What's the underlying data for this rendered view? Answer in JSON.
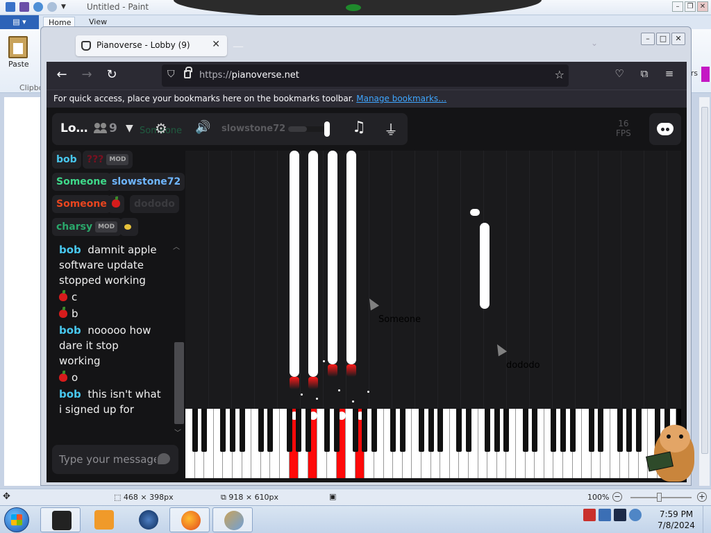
{
  "paint": {
    "title": "Untitled - Paint",
    "tabs": [
      "Home",
      "View"
    ],
    "paste_label": "Paste",
    "clipboard_label": "Clipbo",
    "right_edge_label": "it\nors",
    "status": {
      "selection_size": "468 × 398px",
      "canvas_size": "918 × 610px",
      "zoom": "100%"
    }
  },
  "firefox": {
    "tab_title": "Pianoverse - Lobby (9)",
    "url_proto": "https://",
    "url_host": "pianoverse.net",
    "bookmarks_text": "For quick access, place your bookmarks here on the bookmarks toolbar.",
    "bookmarks_link": "Manage bookmarks…"
  },
  "pianoverse": {
    "room_title": "Lo…",
    "user_count": "9",
    "toolbar_name": "slowstone72",
    "ghost_name": "Someone",
    "volume_level": 0.45,
    "fps_value": "16",
    "fps_label": "FPS",
    "users": [
      {
        "name": "bob",
        "color": "#48c7ee"
      },
      {
        "name": "???",
        "color": "#7a1020",
        "mod": "MOD"
      },
      {
        "name": "Someone",
        "color": "#3fd98a"
      },
      {
        "name": "slowstone72",
        "color": "#6fb6ff"
      },
      {
        "name": "Someone",
        "color": "#e8451f"
      },
      {
        "name": "dododo",
        "color": "#3a3a3e"
      },
      {
        "name": "charsy",
        "color": "#2aa86b",
        "mod": "MOD"
      }
    ],
    "chat": [
      {
        "user": "bob",
        "text": "damnit apple software update stopped working"
      },
      {
        "user": "",
        "text": "c"
      },
      {
        "user": "",
        "text": "b"
      },
      {
        "user": "bob",
        "text": "nooooo how dare it stop working"
      },
      {
        "user": "",
        "text": "o"
      },
      {
        "user": "bob",
        "text": "this isn't what i signed up for"
      }
    ],
    "chat_placeholder": "Type your message",
    "cursor_labels": [
      {
        "name": "Someone",
        "color": "#c8331a"
      },
      {
        "name": "dododo",
        "color": "#3a3a3e"
      }
    ]
  },
  "taskbar": {
    "time": "7:59 PM",
    "date": "7/8/2024"
  },
  "colors": {
    "page_bg": "#141416",
    "panel_bg": "#222226",
    "accent_red": "#ff0a0a",
    "link_blue": "#3ea6ff"
  }
}
